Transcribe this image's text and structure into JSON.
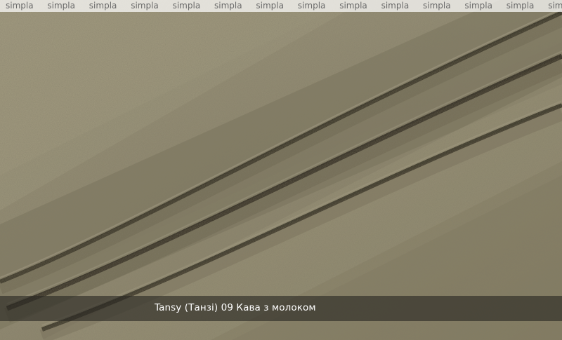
{
  "watermark": {
    "text": "simpla",
    "repeat_count": 14
  },
  "caption": {
    "text": "Tansy (Танзі) 09 Кава з молоком"
  },
  "colors": {
    "fabric_base": "#8f8870",
    "fabric_light": "#a39c82",
    "fabric_shadow": "#3e3a2c",
    "caption_bar": "#2a2824",
    "watermark_bar": "#ffffff"
  }
}
